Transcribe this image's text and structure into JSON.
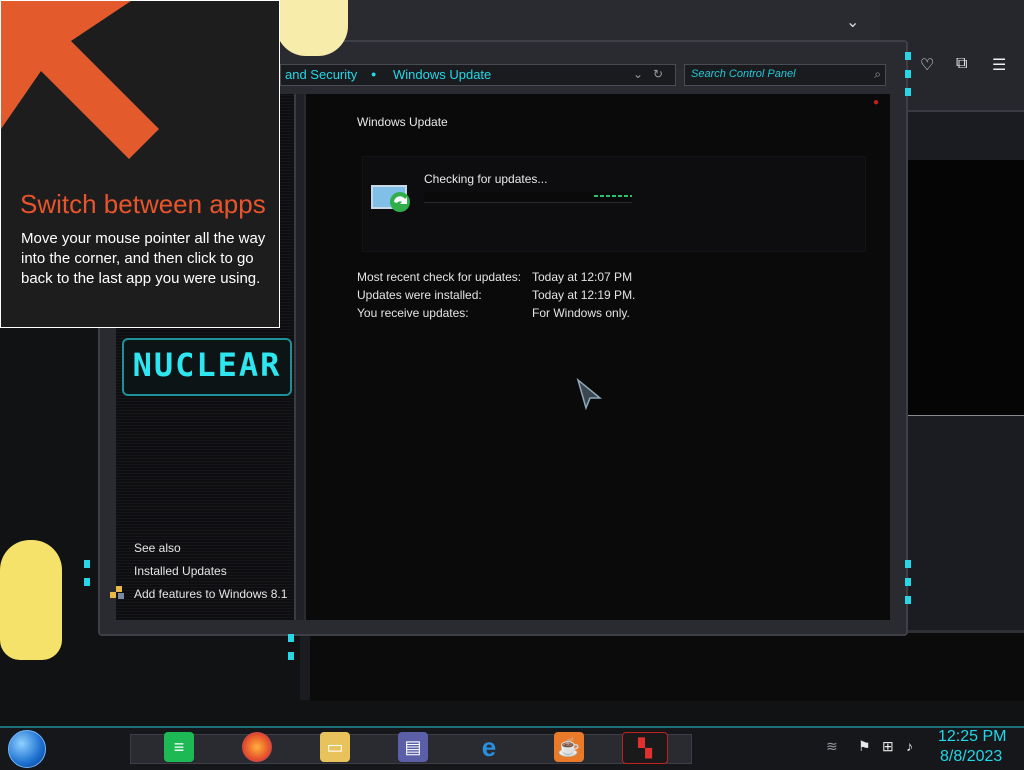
{
  "tip": {
    "title": "Switch between apps",
    "body": "Move your mouse pointer all the way into the corner, and then click to go back to the last app you were using."
  },
  "breadcrumb": {
    "parent": "and Security",
    "current": "Windows Update"
  },
  "search": {
    "placeholder": "Search Control Panel"
  },
  "logo": {
    "text": "NUCLEAR"
  },
  "content": {
    "title": "Windows Update",
    "status": "Checking for updates...",
    "info": [
      {
        "label": "Most recent check for updates:",
        "value": "Today at 12:07 PM"
      },
      {
        "label": "Updates were installed:",
        "value": "Today at 12:19 PM."
      },
      {
        "label": "You receive updates:",
        "value": "For Windows only."
      }
    ]
  },
  "sidebar": {
    "see_also": "See also",
    "installed_updates": "Installed Updates",
    "add_features": "Add features to Windows 8.1"
  },
  "taskbar": {
    "icons": [
      "spotify-icon",
      "firefox-icon",
      "file-explorer-icon",
      "control-panel-icon",
      "internet-explorer-icon",
      "java-icon",
      "nuclear-app-icon"
    ],
    "time": "12:25 PM",
    "date": "8/8/2023"
  },
  "colors": {
    "accent": "#21d8e8",
    "tip_title": "#e8542c",
    "background": "#0a0a0b"
  }
}
